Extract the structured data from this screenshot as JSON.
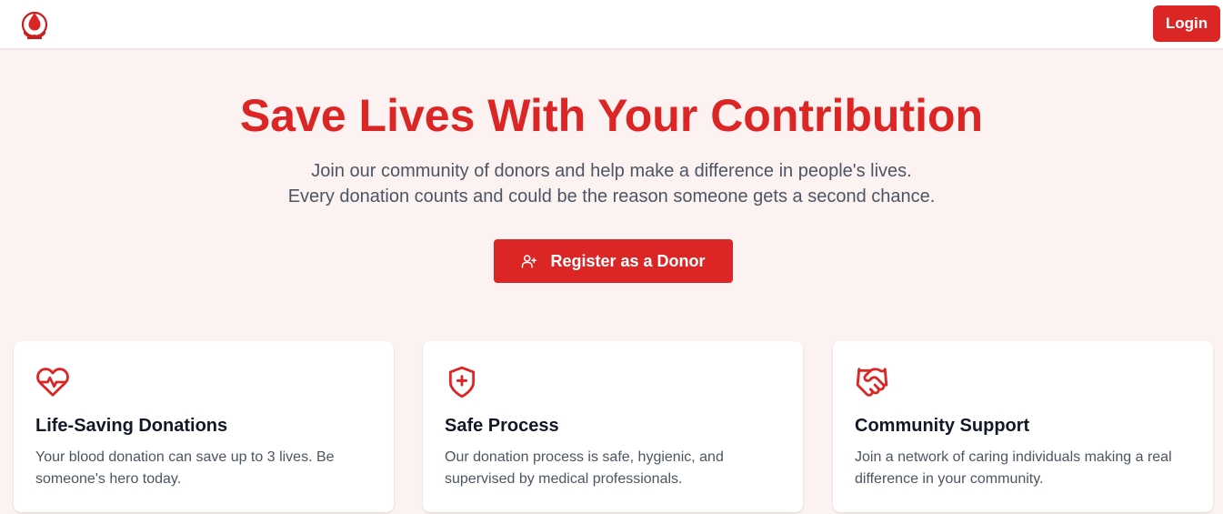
{
  "header": {
    "logo_icon": "blood-drop-hands-logo",
    "login_label": "Login"
  },
  "hero": {
    "title": "Save Lives With Your Contribution",
    "subtitle_line1": "Join our community of donors and help make a difference in people's lives.",
    "subtitle_line2": "Every donation counts and could be the reason someone gets a second chance.",
    "cta_label": "Register as a Donor",
    "cta_icon": "user-plus-icon"
  },
  "features": [
    {
      "icon": "heart-pulse-icon",
      "title": "Life-Saving Donations",
      "text": "Your blood donation can save up to 3 lives. Be someone's hero today."
    },
    {
      "icon": "shield-plus-icon",
      "title": "Safe Process",
      "text": "Our donation process is safe, hygienic, and supervised by medical professionals."
    },
    {
      "icon": "handshake-icon",
      "title": "Community Support",
      "text": "Join a network of caring individuals making a real difference in your community."
    }
  ],
  "colors": {
    "brand_red": "#dc2626",
    "page_background": "#fdf2f2",
    "heading_text": "#111827",
    "body_text": "#4b5563"
  }
}
